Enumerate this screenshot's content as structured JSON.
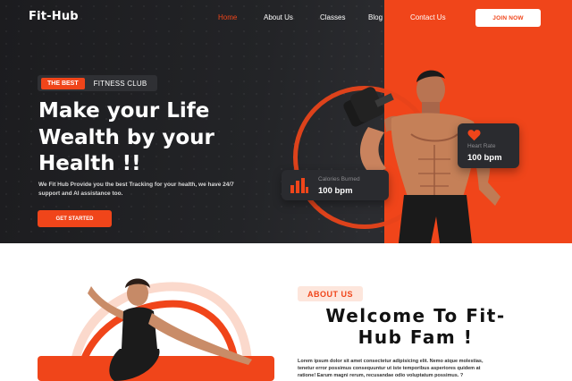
{
  "brand": {
    "logo": "Fit-Hub"
  },
  "nav": {
    "items": [
      "Home",
      "About Us",
      "Classes",
      "Blog",
      "Contact Us"
    ],
    "join_label": "JOIN NOW"
  },
  "hero": {
    "tag_best": "THE BEST",
    "tag_club": "FITNESS CLUB",
    "headline": [
      "Make your Life",
      "Wealth by your",
      "Health !!"
    ],
    "subtitle_lines": [
      "We Fit Hub Provide you the best Tracking for your health, we have 24/7",
      "support and AI assistance too."
    ],
    "cta_label": "GET STARTED"
  },
  "stats": {
    "calories": {
      "label": "Calories Burned",
      "value": "100 bpm",
      "icon": "bar-chart-icon"
    },
    "heart": {
      "label": "Heart Rate",
      "value": "100 bpm",
      "icon": "heart-icon"
    }
  },
  "about": {
    "badge": "ABOUT US",
    "title_lines": [
      "Welcome To Fit-",
      "Hub Fam !"
    ],
    "body_lines": [
      "Lorem ipsum dolor sit amet consectetur adipisicing elit. Nemo atque molestias,",
      "tenetur error possimus consequuntur ut iste temporibus asperiores quidem at",
      "ratione! Earum magni rerum, recusandae odio voluptatum possimus. ?"
    ]
  },
  "colors": {
    "accent": "#f0451a",
    "dark": "#1f2023",
    "card": "#2a2b2f"
  }
}
